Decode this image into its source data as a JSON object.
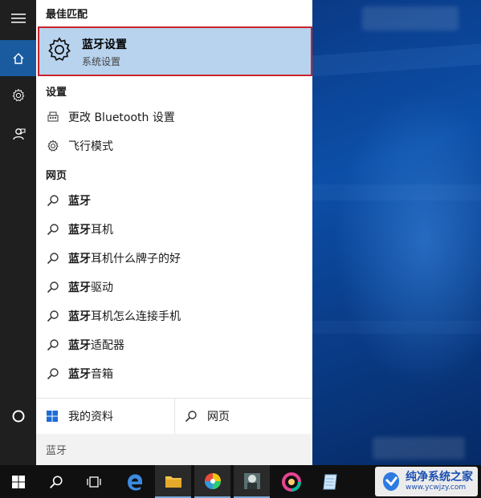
{
  "search_panel": {
    "best_match_header": "最佳匹配",
    "best_match": {
      "title": "蓝牙设置",
      "subtitle": "系统设置"
    },
    "settings_header": "设置",
    "settings_items": [
      {
        "label": "更改 Bluetooth 设置",
        "icon": "bluetooth-device-icon"
      },
      {
        "label": "飞行模式",
        "icon": "gear-icon"
      }
    ],
    "web_header": "网页",
    "web_items": [
      {
        "bold": "蓝牙",
        "rest": ""
      },
      {
        "bold": "蓝牙",
        "rest": "耳机"
      },
      {
        "bold": "蓝牙",
        "rest": "耳机什么牌子的好"
      },
      {
        "bold": "蓝牙",
        "rest": "驱动"
      },
      {
        "bold": "蓝牙",
        "rest": "耳机怎么连接手机"
      },
      {
        "bold": "蓝牙",
        "rest": "适配器"
      },
      {
        "bold": "蓝牙",
        "rest": "音箱"
      }
    ],
    "my_stuff_label": "我的资料",
    "web_search_label": "网页",
    "search_query": "蓝牙"
  },
  "watermark": {
    "name": "纯净系统之家",
    "url": "www.ycwjzy.com"
  },
  "colors": {
    "highlight": "#b8d3ee",
    "highlight_border": "#c9232c",
    "rail": "#1f1f1f",
    "rail_active": "#1a5ba0",
    "taskbar": "#101010"
  }
}
